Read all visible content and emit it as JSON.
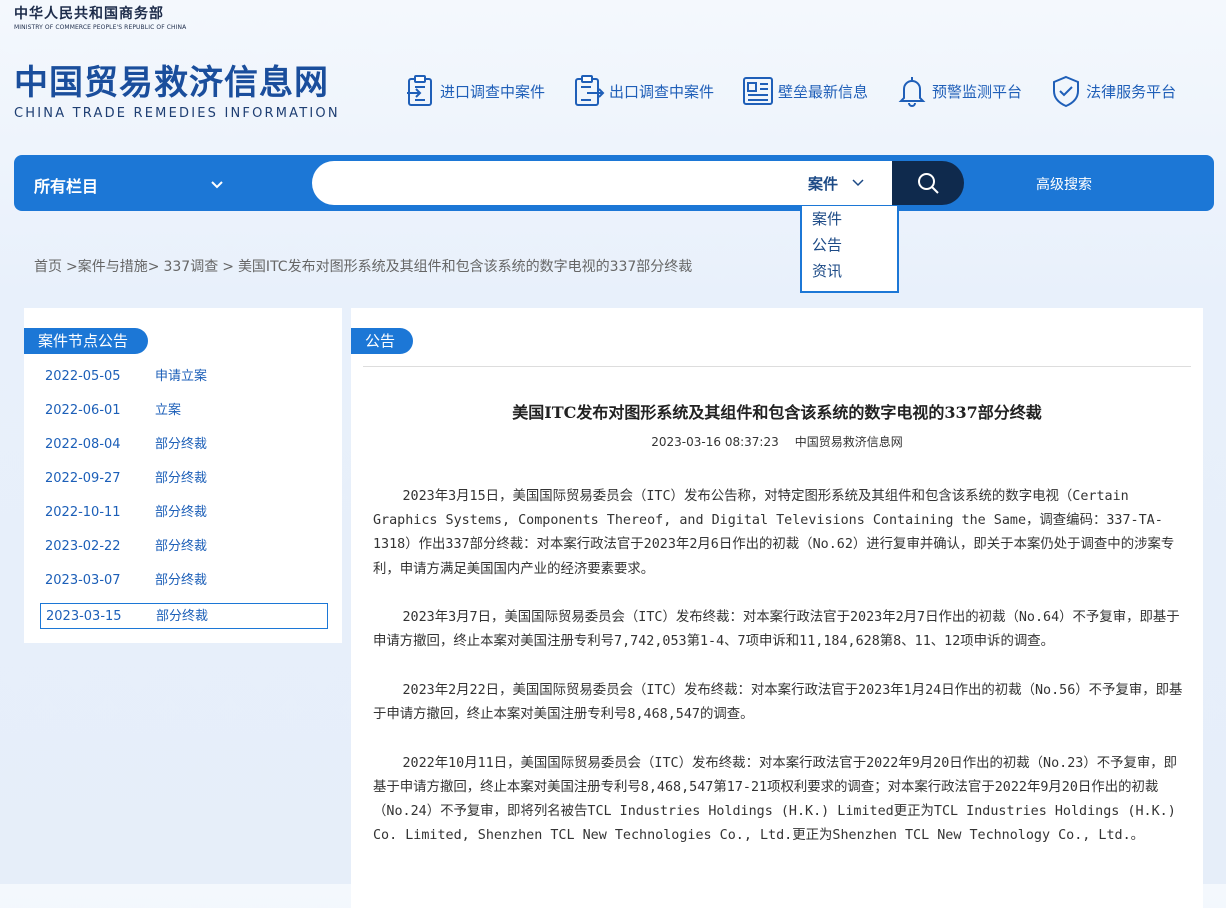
{
  "header": {
    "ministry_cn": "中华人民共和国商务部",
    "ministry_en": "MINISTRY OF COMMERCE PEOPLE'S REPUBLIC OF CHINA",
    "site_cn": "中国贸易救济信息网",
    "site_en": "CHINA TRADE REMEDIES INFORMATION"
  },
  "topnav": [
    {
      "label": "进口调查中案件",
      "icon": "import-clipboard-icon"
    },
    {
      "label": "出口调查中案件",
      "icon": "export-clipboard-icon"
    },
    {
      "label": "壁垒最新信息",
      "icon": "news-document-icon"
    },
    {
      "label": "预警监测平台",
      "icon": "bell-icon"
    },
    {
      "label": "法律服务平台",
      "icon": "shield-check-icon"
    }
  ],
  "search": {
    "category_label": "所有栏目",
    "type_selected": "案件",
    "query": "",
    "advanced_label": "高级搜索",
    "type_options": [
      "案件",
      "公告",
      "资讯"
    ]
  },
  "breadcrumb": [
    "首页",
    ">案件与措施>",
    "337调查",
    ">",
    "美国ITC发布对图形系统及其组件和包含该系统的数字电视的337部分终裁"
  ],
  "sidebar": {
    "heading": "案件节点公告",
    "nodes": [
      {
        "date": "2022-05-05",
        "label": "申请立案"
      },
      {
        "date": "2022-06-01",
        "label": "立案"
      },
      {
        "date": "2022-08-04",
        "label": "部分终裁"
      },
      {
        "date": "2022-09-27",
        "label": "部分终裁"
      },
      {
        "date": "2022-10-11",
        "label": "部分终裁"
      },
      {
        "date": "2023-02-22",
        "label": "部分终裁"
      },
      {
        "date": "2023-03-07",
        "label": "部分终裁"
      },
      {
        "date": "2023-03-15",
        "label": "部分终裁"
      }
    ],
    "selected_index": 7
  },
  "article": {
    "section": "公告",
    "title": "美国ITC发布对图形系统及其组件和包含该系统的数字电视的337部分终裁",
    "timestamp": "2023-03-16 08:37:23",
    "source": "中国贸易救济信息网",
    "paragraphs": [
      "2023年3月15日，美国国际贸易委员会（ITC）发布公告称，对特定图形系统及其组件和包含该系统的数字电视（Certain Graphics Systems, Components Thereof, and Digital Televisions Containing the Same，调查编码：337-TA-1318）作出337部分终裁：对本案行政法官于2023年2月6日作出的初裁（No.62）进行复审并确认，即关于本案仍处于调查中的涉案专利，申请方满足美国国内产业的经济要素要求。",
      "2023年3月7日，美国国际贸易委员会（ITC）发布终裁：对本案行政法官于2023年2月7日作出的初裁（No.64）不予复审，即基于申请方撤回，终止本案对美国注册专利号7,742,053第1-4、7项申诉和11,184,628第8、11、12项申诉的调查。",
      "2023年2月22日，美国国际贸易委员会（ITC）发布终裁：对本案行政法官于2023年1月24日作出的初裁（No.56）不予复审，即基于申请方撤回，终止本案对美国注册专利号8,468,547的调查。",
      "2022年10月11日，美国国际贸易委员会（ITC）发布终裁：对本案行政法官于2022年9月20日作出的初裁（No.23）不予复审，即基于申请方撤回，终止本案对美国注册专利号8,468,547第17-21项权利要求的调查；对本案行政法官于2022年9月20日作出的初裁（No.24）不予复审，即将列名被告TCL Industries Holdings (H.K.) Limited更正为TCL Industries Holdings (H.K.) Co. Limited, Shenzhen TCL New Technologies Co., Ltd.更正为Shenzhen TCL New Technology Co., Ltd.。"
    ]
  }
}
